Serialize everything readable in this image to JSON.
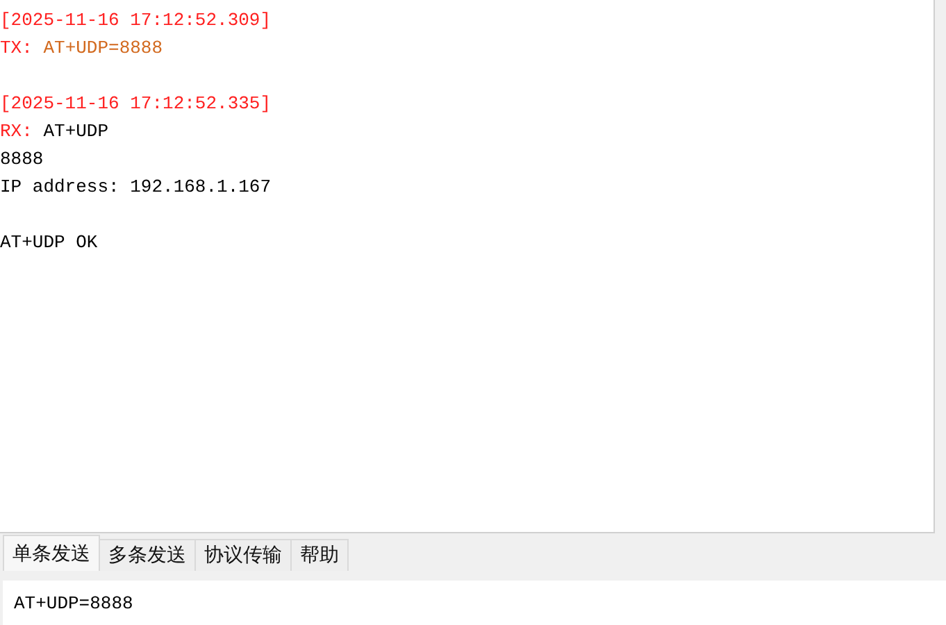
{
  "log": [
    {
      "kind": "timestamp",
      "text": "[2025-11-16 17:12:52.309]"
    },
    {
      "kind": "tx",
      "prefix": "TX:",
      "text": "AT+UDP=8888"
    },
    {
      "kind": "gap"
    },
    {
      "kind": "timestamp",
      "text": "[2025-11-16 17:12:52.335]"
    },
    {
      "kind": "rx",
      "prefix": "RX:",
      "text": "AT+UDP"
    },
    {
      "kind": "plain",
      "text": "8888"
    },
    {
      "kind": "plain",
      "text": "IP address: 192.168.1.167"
    },
    {
      "kind": "gap"
    },
    {
      "kind": "plain",
      "text": "AT+UDP OK"
    }
  ],
  "tabs": [
    {
      "label": "单条发送",
      "selected": true
    },
    {
      "label": "多条发送",
      "selected": false
    },
    {
      "label": "协议传输",
      "selected": false
    },
    {
      "label": "帮助",
      "selected": false
    }
  ],
  "send_field": {
    "value": "AT+UDP=8888"
  }
}
